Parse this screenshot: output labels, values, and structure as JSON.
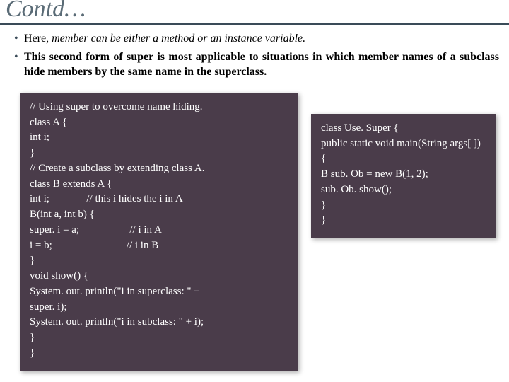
{
  "title": "Contd…",
  "bullets": {
    "b1_pre": "Here, ",
    "b1_em": "member can be either a method or an instance variable.",
    "b2": "This second form of super is most applicable to situations in which member names of a subclass hide members by the same name in the superclass."
  },
  "code": {
    "left": "// Using super to overcome name hiding.\nclass A {\nint i;\n}\n// Create a subclass by extending class A.\nclass B extends A {\nint i;              // this i hides the i in A\nB(int a, int b) {\nsuper. i = a;                   // i in A\ni = b;                            // i in B\n}\nvoid show() {\nSystem. out. println(\"i in superclass: \" +\nsuper. i);\nSystem. out. println(\"i in subclass: \" + i);\n}\n}",
    "right": "class Use. Super {\npublic static void main(String args[ ])\n{\nB sub. Ob = new B(1, 2);\nsub. Ob. show();\n}\n}"
  }
}
